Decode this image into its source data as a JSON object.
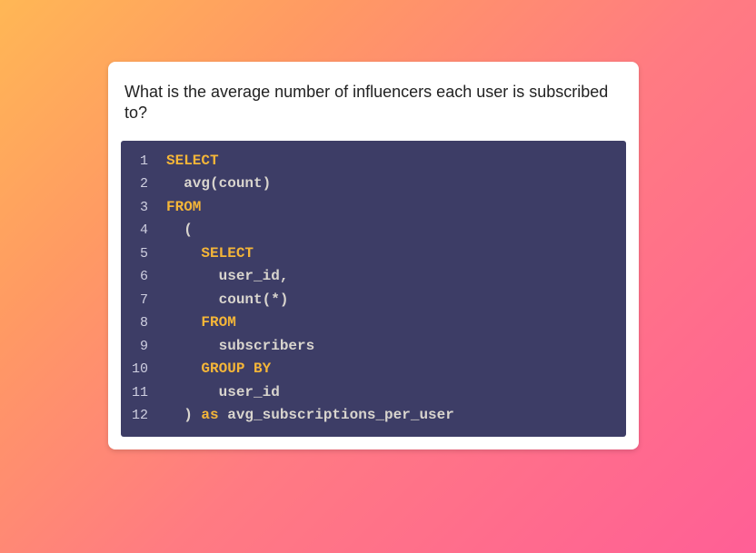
{
  "question": "What is the average number of influencers each user is subscribed to?",
  "code": {
    "lines": [
      {
        "n": "1",
        "indent": 0,
        "tokens": [
          {
            "t": "SELECT",
            "c": "kw"
          }
        ]
      },
      {
        "n": "2",
        "indent": 1,
        "tokens": [
          {
            "t": "avg(count)",
            "c": "txt"
          }
        ]
      },
      {
        "n": "3",
        "indent": 0,
        "tokens": [
          {
            "t": "FROM",
            "c": "kw"
          }
        ]
      },
      {
        "n": "4",
        "indent": 1,
        "tokens": [
          {
            "t": "(",
            "c": "txt"
          }
        ]
      },
      {
        "n": "5",
        "indent": 2,
        "tokens": [
          {
            "t": "SELECT",
            "c": "kw"
          }
        ]
      },
      {
        "n": "6",
        "indent": 3,
        "tokens": [
          {
            "t": "user_id,",
            "c": "txt"
          }
        ]
      },
      {
        "n": "7",
        "indent": 3,
        "tokens": [
          {
            "t": "count(*)",
            "c": "txt"
          }
        ]
      },
      {
        "n": "8",
        "indent": 2,
        "tokens": [
          {
            "t": "FROM",
            "c": "kw"
          }
        ]
      },
      {
        "n": "9",
        "indent": 3,
        "tokens": [
          {
            "t": "subscribers",
            "c": "txt"
          }
        ]
      },
      {
        "n": "10",
        "indent": 2,
        "tokens": [
          {
            "t": "GROUP BY",
            "c": "kw"
          }
        ]
      },
      {
        "n": "11",
        "indent": 3,
        "tokens": [
          {
            "t": "user_id",
            "c": "txt"
          }
        ]
      },
      {
        "n": "12",
        "indent": 1,
        "tokens": [
          {
            "t": ") ",
            "c": "txt"
          },
          {
            "t": "as",
            "c": "kw"
          },
          {
            "t": " avg_subscriptions_per_user",
            "c": "txt"
          }
        ]
      }
    ]
  }
}
